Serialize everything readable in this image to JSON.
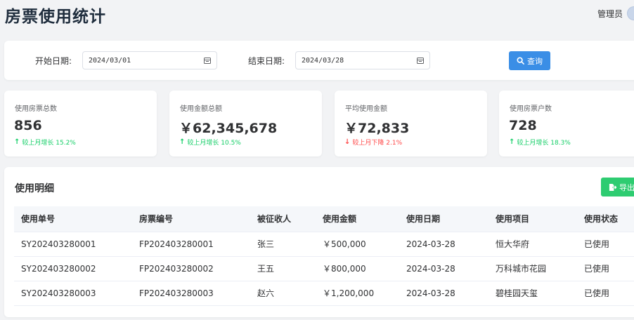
{
  "header": {
    "title": "房票使用统计",
    "user_name": "管理员"
  },
  "filters": {
    "start_label": "开始日期:",
    "start_value": "2024/03/01",
    "end_label": "结束日期:",
    "end_value": "2024/03/28",
    "query_label": "查询"
  },
  "stats": [
    {
      "label": "使用房票总数",
      "value": "856",
      "change": "较上月增长 15.2%",
      "direction": "up"
    },
    {
      "label": "使用金额总额",
      "value": "￥62,345,678",
      "change": "较上月增长 10.5%",
      "direction": "up"
    },
    {
      "label": "平均使用金额",
      "value": "￥72,833",
      "change": "较上月下降 2.1%",
      "direction": "down"
    },
    {
      "label": "使用房票户数",
      "value": "728",
      "change": "较上月增长 18.3%",
      "direction": "up"
    }
  ],
  "detail": {
    "title": "使用明细",
    "export_label": "导出",
    "columns": [
      "使用单号",
      "房票编号",
      "被征收人",
      "使用金额",
      "使用日期",
      "使用项目",
      "使用状态"
    ],
    "rows": [
      [
        "SY202403280001",
        "FP202403280001",
        "张三",
        "￥500,000",
        "2024-03-28",
        "恒大华府",
        "已使用"
      ],
      [
        "SY202403280002",
        "FP202403280002",
        "王五",
        "￥800,000",
        "2024-03-28",
        "万科城市花园",
        "已使用"
      ],
      [
        "SY202403280003",
        "FP202403280003",
        "赵六",
        "￥1,200,000",
        "2024-03-28",
        "碧桂园天玺",
        "已使用"
      ]
    ]
  },
  "colors": {
    "primary": "#3a8ee6",
    "success": "#2ecc71",
    "up": "#13ce66",
    "down": "#ff4949"
  },
  "icons": {
    "calendar": "calendar-icon",
    "search": "search-icon",
    "export": "export-icon",
    "up": "arrow-up-icon",
    "down": "arrow-down-icon"
  }
}
